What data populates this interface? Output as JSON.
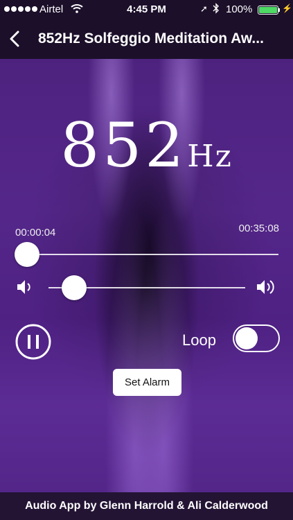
{
  "status_bar": {
    "carrier": "Airtel",
    "time": "4:45 PM",
    "battery_percent": "100%",
    "battery_level": 1.0,
    "icons": [
      "signal-dots-icon",
      "wifi-icon",
      "location-arrow-icon",
      "bluetooth-icon",
      "battery-icon",
      "charging-bolt-icon"
    ]
  },
  "nav": {
    "back_icon": "chevron-left-icon",
    "title": "852Hz Solfeggio Meditation Aw..."
  },
  "player": {
    "frequency_number": "852",
    "frequency_unit": "Hz",
    "elapsed": "00:00:04",
    "total": "00:35:08",
    "progress_fraction": 0.002,
    "volume_fraction": 0.13,
    "loop_label": "Loop",
    "loop_enabled": false,
    "alarm_label": "Set Alarm"
  },
  "footer": {
    "credit": "Audio App by Glenn Harrold & Ali Calderwood"
  },
  "colors": {
    "bar_background": "#1c0f2a",
    "battery_green": "#4cd964",
    "background_purple": "#4b2478"
  }
}
